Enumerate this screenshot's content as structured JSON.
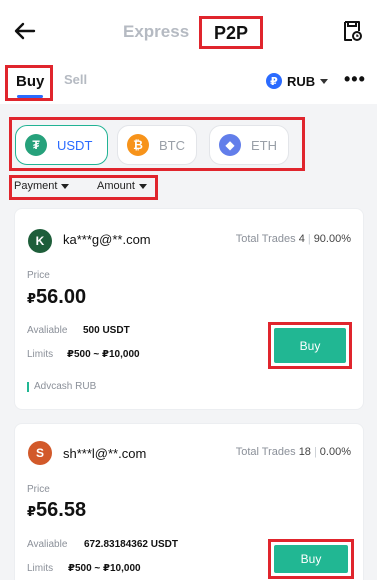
{
  "header": {
    "back_icon": "arrow-left-icon",
    "mode_tabs": [
      "Express",
      "P2P"
    ],
    "orders_icon": "orders-icon"
  },
  "subheader": {
    "tabs": [
      "Buy",
      "Sell"
    ],
    "currency": "RUB",
    "currency_symbol": "₽",
    "more_label": "•••"
  },
  "coins": [
    {
      "label": "USDT",
      "symbol": "₮",
      "color": "#26a17b",
      "selected": true
    },
    {
      "label": "BTC",
      "symbol": "₿",
      "color": "#f7931a",
      "selected": false
    },
    {
      "label": "ETH",
      "symbol": "◆",
      "color": "#627eea",
      "selected": false
    }
  ],
  "filters": [
    "Payment",
    "Amount"
  ],
  "offers": [
    {
      "avatar_letter": "K",
      "avatar_color": "#1e5e3a",
      "email": "ka***g@**.com",
      "trades_label": "Total Trades",
      "trades_count": "4",
      "completion": "90.00%",
      "price_label": "Price",
      "price_symbol": "₽",
      "price": "56.00",
      "available_label": "Avaliable",
      "available": "500 USDT",
      "limits_label": "Limits",
      "limits": "₽500 ~ ₽10,000",
      "buy_label": "Buy",
      "payment": "Advcash RUB"
    },
    {
      "avatar_letter": "S",
      "avatar_color": "#d2592a",
      "email": "sh***l@**.com",
      "trades_label": "Total Trades",
      "trades_count": "18",
      "completion": "0.00%",
      "price_label": "Price",
      "price_symbol": "₽",
      "price": "56.58",
      "available_label": "Avaliable",
      "available": "672.83184362 USDT",
      "limits_label": "Limits",
      "limits": "₽500 ~ ₽10,000",
      "buy_label": "Buy"
    }
  ],
  "colors": {
    "accent_green": "#21b793",
    "accent_blue": "#2b6bff",
    "highlight_red": "#e0252d"
  }
}
